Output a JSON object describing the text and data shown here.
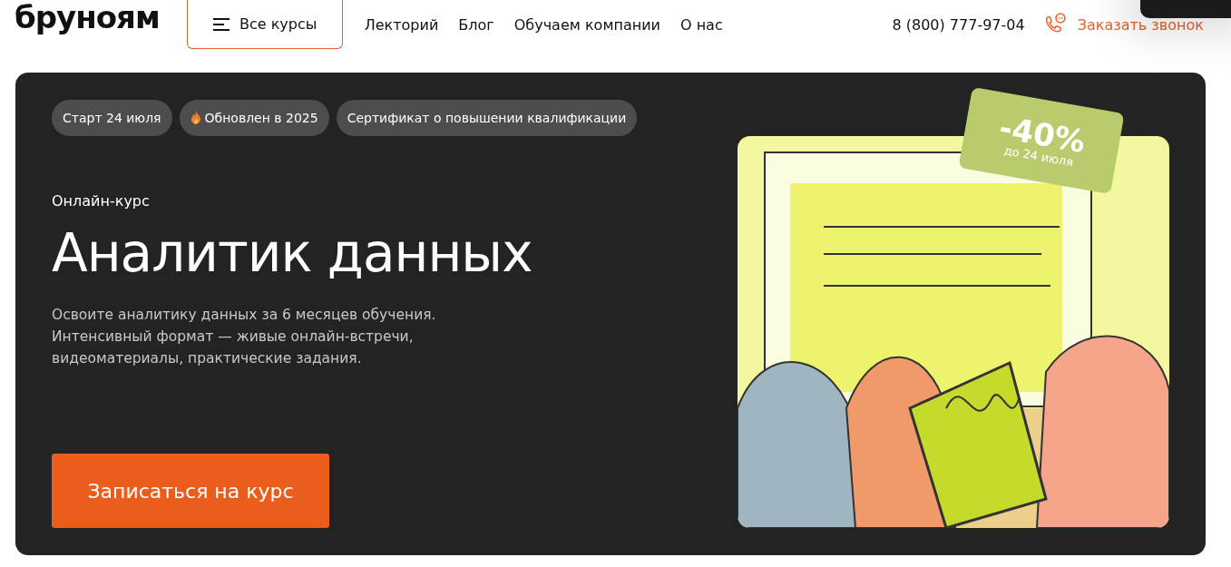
{
  "header": {
    "logo": "бруноям",
    "catalog_button": "Все курсы",
    "nav": [
      "Лекторий",
      "Блог",
      "Обучаем компании",
      "О нас"
    ],
    "phone": "8 (800) 777-97-04",
    "callback": "Заказать звонок"
  },
  "hero": {
    "tags": [
      {
        "label": "Старт 24 июля",
        "kind": "plain"
      },
      {
        "label": "Обновлен в 2025",
        "kind": "fire"
      },
      {
        "label": "Сертификат о повышении квалификации",
        "kind": "plain"
      }
    ],
    "eyebrow": "Онлайн-курс",
    "title": "Аналитик данных",
    "description": "Освоите аналитику данных за 6 месяцев обучения. Интенсивный формат — живые онлайн-встречи, видеоматериалы, практические задания.",
    "cta": "Записаться на курс",
    "discount": {
      "value": "-40%",
      "until": "до 24 июля"
    }
  }
}
